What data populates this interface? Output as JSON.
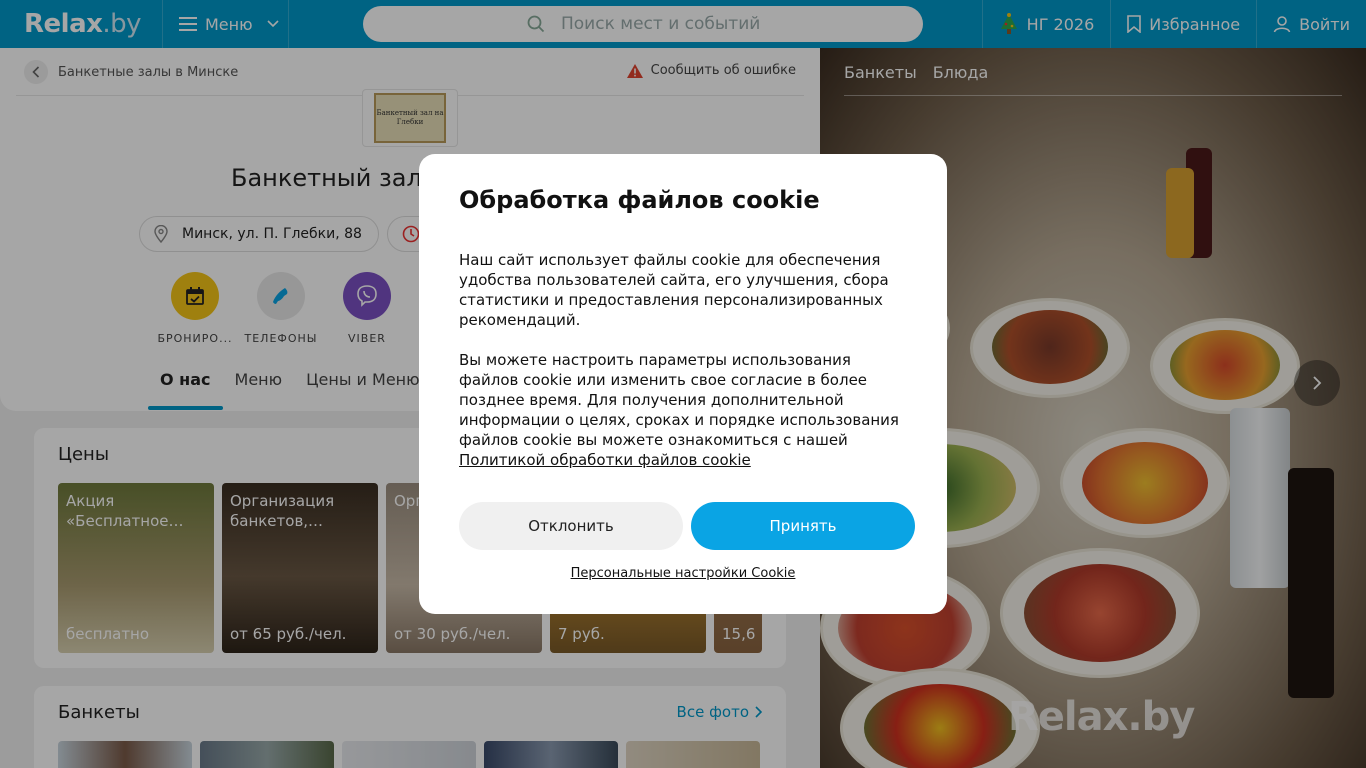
{
  "header": {
    "logo": "Relax",
    "logo_suffix": ".by",
    "menu_label": "Меню",
    "search_placeholder": "Поиск мест и событий",
    "ny_label": "НГ 2026",
    "favorites_label": "Избранное",
    "login_label": "Войти"
  },
  "breadcrumb": {
    "label": "Банкетные залы в Минске"
  },
  "report_label": "Сообщить об ошибке",
  "venue": {
    "logo_text": "Банкетный зал на Глебки",
    "title": "Банкетный зал",
    "address": "Минск, ул. П. Глебки, 88"
  },
  "actions": [
    {
      "label": "БРОНИРО...",
      "color": "#f5c518",
      "icon": "calendar-check-icon"
    },
    {
      "label": "ТЕЛЕФОНЫ",
      "color": "#e8e8e8",
      "icon": "phone-icon"
    },
    {
      "label": "VIBER",
      "color": "#7b51c4",
      "icon": "viber-icon"
    }
  ],
  "tabs": [
    "О нас",
    "Меню",
    "Цены и Меню"
  ],
  "prices": {
    "title": "Цены",
    "tiles": [
      {
        "title": "Акция «Бесплатное…",
        "price": "бесплатно",
        "color": "#8c8a5a"
      },
      {
        "title": "Организация банкетов,…",
        "price": "от 65 руб./чел.",
        "color": "#4a3a2a"
      },
      {
        "title": "Орг… пом…",
        "price": "от 30 руб./чел.",
        "color": "#b0a090"
      },
      {
        "title": "",
        "price": "7 руб.",
        "color": "#c08a30"
      },
      {
        "title": "",
        "price": "15,6",
        "color": "#a07850"
      }
    ]
  },
  "banquets": {
    "title": "Банкеты",
    "all_photos": "Все фото"
  },
  "gallery_tabs": [
    "Банкеты",
    "Блюда"
  ],
  "watermark": "Relax.by",
  "cookie": {
    "title": "Обработка файлов cookie",
    "para1": "Наш сайт использует файлы cookie для обеспечения удобства пользователей сайта, его улучшения, сбора статистики и предоставления персонализированных рекомендаций.",
    "para2": "Вы можете настроить параметры использования файлов cookie или изменить свое согласие в более позднее время. Для получения дополнительной информации о целях, сроках и порядке использования файлов cookie вы можете ознакомиться с нашей",
    "policy_link": "Политикой обработки файлов cookie",
    "decline": "Отклонить",
    "accept": "Принять",
    "personal": "Персональные настройки Cookie"
  },
  "colors": {
    "brand": "#0098c9",
    "accept": "#0aa4e4"
  }
}
